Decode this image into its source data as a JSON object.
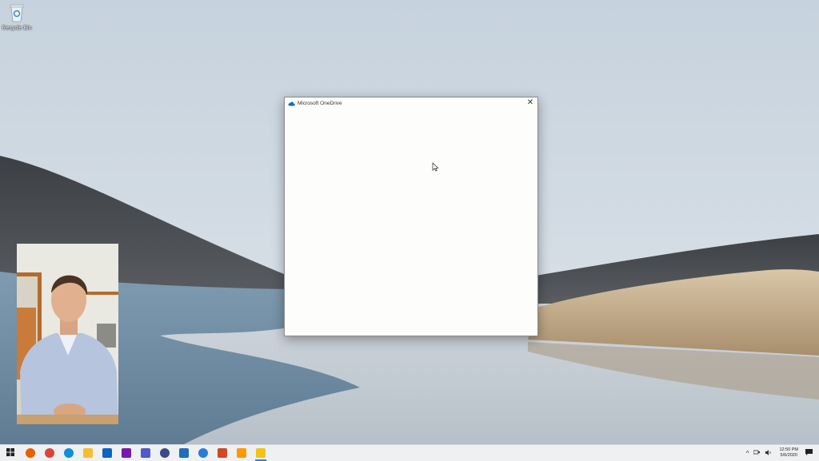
{
  "desktop": {
    "icons": [
      {
        "label": "Recycle Bin",
        "icon": "recycle-bin-icon"
      }
    ]
  },
  "window": {
    "title": "Microsoft OneDrive",
    "app_icon": "onedrive-cloud-icon",
    "close_symbol": "✕"
  },
  "taskbar": {
    "pinned": [
      {
        "name": "firefox",
        "icon": "firefox-icon",
        "color": "#e66000"
      },
      {
        "name": "chrome",
        "icon": "chrome-icon",
        "color": "#db4437"
      },
      {
        "name": "edge",
        "icon": "edge-icon",
        "color": "#0c8fd6"
      },
      {
        "name": "file-explorer",
        "icon": "folder-icon",
        "color": "#f4c030"
      },
      {
        "name": "outlook",
        "icon": "outlook-icon",
        "color": "#0a64c2"
      },
      {
        "name": "onenote",
        "icon": "onenote-icon",
        "color": "#7719aa"
      },
      {
        "name": "teams",
        "icon": "teams-icon",
        "color": "#5059c9"
      },
      {
        "name": "app-circle",
        "icon": "app-circle-icon",
        "color": "#3a4a8a"
      },
      {
        "name": "remote-app",
        "icon": "remote-app-icon",
        "color": "#1e6fb8"
      },
      {
        "name": "chat-app",
        "icon": "chat-app-icon",
        "color": "#2a7ad8"
      },
      {
        "name": "powerpoint",
        "icon": "powerpoint-icon",
        "color": "#d24726"
      },
      {
        "name": "sublime",
        "icon": "sublime-text-icon",
        "color": "#ff9800"
      },
      {
        "name": "onedrive-setup",
        "icon": "onedrive-setup-icon",
        "color": "#f0c419"
      }
    ],
    "tray": {
      "chevron": "^",
      "clock_time": "12:50 PM",
      "clock_date": "5/6/2020"
    }
  }
}
